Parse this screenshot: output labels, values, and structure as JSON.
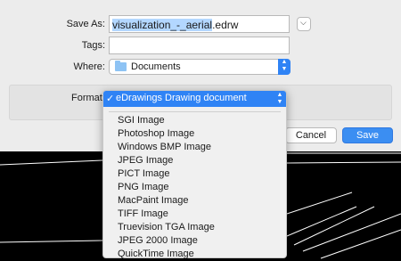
{
  "dialog": {
    "save_as_label": "Save As:",
    "filename_selected": "visualization_-_aerial",
    "filename_ext": ".edrw",
    "tags_label": "Tags:",
    "tags_value": "",
    "where_label": "Where:",
    "where_value": "Documents",
    "format_label": "Format:",
    "cancel_label": "Cancel",
    "save_label": "Save"
  },
  "format_menu": {
    "selected": "eDrawings Drawing document",
    "check": "✓",
    "items": [
      "SGI Image",
      "Photoshop Image",
      "Windows BMP Image",
      "JPEG Image",
      "PICT Image",
      "PNG Image",
      "MacPaint Image",
      "TIFF Image",
      "Truevision TGA Image",
      "JPEG 2000 Image",
      "QuickTime Image"
    ]
  },
  "icons": {
    "expand": "chevron-down-icon",
    "folder": "folder-icon",
    "updown": "updown-chevrons-icon"
  },
  "colors": {
    "accent": "#2f83f5",
    "sheet_bg": "#ececec",
    "backdrop": "#000000"
  }
}
